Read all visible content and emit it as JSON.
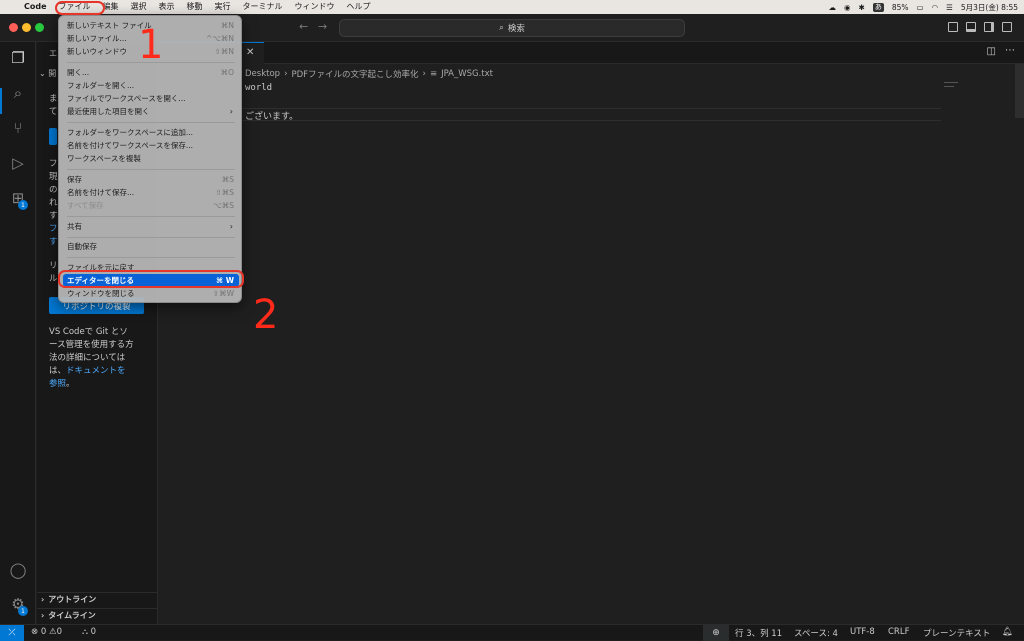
{
  "menubar": {
    "app": "Code",
    "items": [
      "ファイル",
      "編集",
      "選択",
      "表示",
      "移動",
      "実行",
      "ターミナル",
      "ウィンドウ",
      "ヘルプ"
    ],
    "input_badge": "あ",
    "battery": "85%",
    "clock": "5月3日(金) 8:55"
  },
  "titlebar": {
    "search": "検索"
  },
  "sidebar": {
    "title": "エ",
    "section": "開",
    "lines_a": [
      "ま",
      "て"
    ],
    "lines_b": [
      "フ",
      "現",
      "の",
      "れ",
      "す"
    ],
    "link_b": [
      "フ",
      "す"
    ],
    "lines_c": [
      "リ",
      "ル"
    ],
    "clone_button": "リポジトリの複製",
    "git_text": [
      "VS Codeで Git とソ",
      "ース管理を使用する方",
      "法の詳細については",
      "は、"
    ],
    "git_link1": "ドキュメントを",
    "git_link2": "参照",
    "git_end": "。",
    "outline": "アウトライン",
    "timeline": "タイムライン"
  },
  "activity": {
    "extensions_badge": "1",
    "settings_badge": "1"
  },
  "editor": {
    "breadcrumb": [
      "Desktop",
      "PDFファイルの文字起こし効率化",
      "JPA_WSG.txt"
    ],
    "line1": "world",
    "line3": "ございます。"
  },
  "file_menu": {
    "items": [
      {
        "label": "新しいテキスト ファイル",
        "shortcut": "⌘N"
      },
      {
        "label": "新しいファイル...",
        "shortcut": "^⌥⌘N"
      },
      {
        "label": "新しいウィンドウ",
        "shortcut": "⇧⌘N"
      },
      {
        "label": "開く...",
        "shortcut": "⌘O"
      },
      {
        "label": "フォルダーを開く...",
        "shortcut": ""
      },
      {
        "label": "ファイルでワークスペースを開く...",
        "shortcut": ""
      },
      {
        "label": "最近使用した項目を開く",
        "shortcut": ""
      },
      {
        "label": "フォルダーをワークスペースに追加...",
        "shortcut": ""
      },
      {
        "label": "名前を付けてワークスペースを保存...",
        "shortcut": ""
      },
      {
        "label": "ワークスペースを複製",
        "shortcut": ""
      },
      {
        "label": "保存",
        "shortcut": "⌘S"
      },
      {
        "label": "名前を付けて保存...",
        "shortcut": "⇧⌘S"
      },
      {
        "label": "すべて保存",
        "shortcut": "⌥⌘S"
      },
      {
        "label": "共有",
        "shortcut": ""
      },
      {
        "label": "自動保存",
        "shortcut": ""
      },
      {
        "label": "ファイルを元に戻す",
        "shortcut": ""
      },
      {
        "label": "エディターを閉じる",
        "shortcut": "⌘ W"
      },
      {
        "label": "ウィンドウを閉じる",
        "shortcut": "⇧⌘W"
      }
    ]
  },
  "annotations": {
    "step1": "1",
    "step2": "2"
  },
  "statusbar": {
    "errors": "0",
    "warnings": "0",
    "ports": "0",
    "position": "行 3、列 11",
    "spaces": "スペース: 4",
    "encoding": "UTF-8",
    "eol": "CRLF",
    "language": "プレーンテキスト"
  }
}
